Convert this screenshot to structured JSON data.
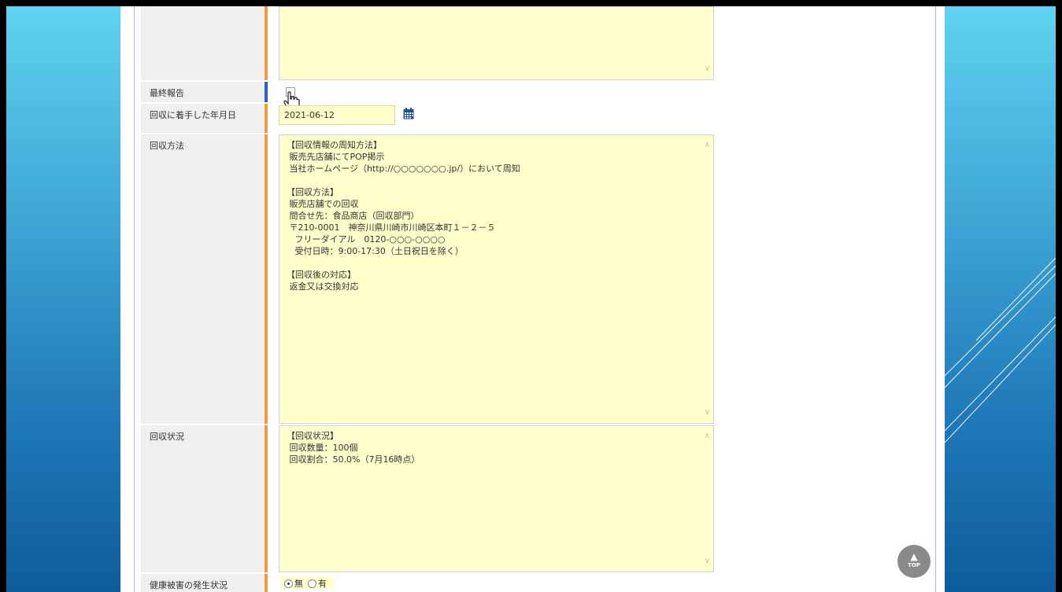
{
  "form": {
    "final_report": {
      "label": "最終報告",
      "checked": false
    },
    "recall_start_date": {
      "label": "回収に着手した年月日",
      "value": "2021-06-12",
      "icon": "calendar-icon"
    },
    "recall_method": {
      "label": "回収方法",
      "value": "【回収情報の周知方法】\n 販売先店舗にてPOP掲示\n 当社ホームページ（http://○○○○○○○.jp/）において周知\n\n【回収方法】\n 販売店舗での回収\n 問合せ先：食品商店（回収部門）\n 〒210-0001　神奈川県川崎市川崎区本町１－２－５\n   フリーダイアル　0120-○○○-○○○○\n   受付日時：9:00-17:30（土日祝日を除く）\n\n【回収後の対応】\n 返金又は交換対応"
    },
    "recall_status": {
      "label": "回収状況",
      "value": "【回収状況】\n 回収数量：100個\n 回収割合：50.0%（7月16時点）"
    },
    "health_damage": {
      "label": "健康被害の発生状況",
      "options": [
        "無",
        "有"
      ],
      "selected": "無"
    }
  },
  "scroll_top_button": {
    "label": "TOP"
  },
  "colors": {
    "textarea_bg": "#ffffcc",
    "label_bg": "#efefef",
    "required_bar": "#f39a3e",
    "optional_bar": "#2f60c8",
    "calendar_icon": "#1f4e9c"
  }
}
